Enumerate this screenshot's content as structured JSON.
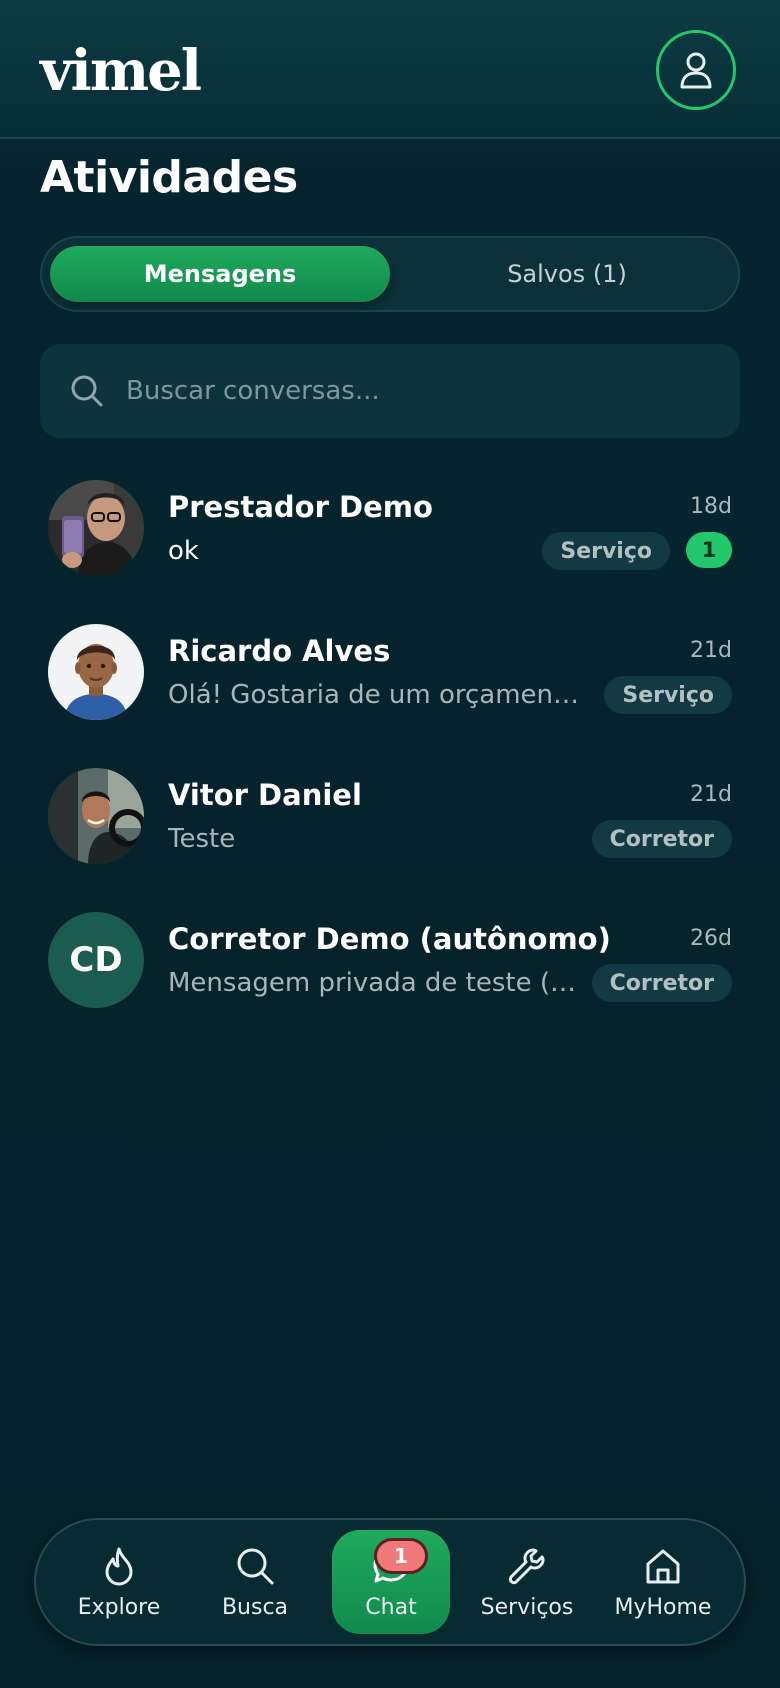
{
  "header": {
    "logo_text": "vimel",
    "profile_icon": "user-icon"
  },
  "page": {
    "title": "Atividades"
  },
  "tabs": [
    {
      "label": "Mensagens",
      "active": true
    },
    {
      "label": "Salvos (1)",
      "active": false
    }
  ],
  "search": {
    "placeholder": "Buscar conversas...",
    "value": "",
    "icon": "search-icon"
  },
  "conversations": [
    {
      "name": "Prestador Demo",
      "message": "ok",
      "time": "18d",
      "tag": "Serviço",
      "unread": "1",
      "avatar": "photo-avatar"
    },
    {
      "name": "Ricardo Alves",
      "message": "Olá! Gostaria de um orçamento para...",
      "time": "21d",
      "tag": "Serviço",
      "avatar": "illustrated-avatar"
    },
    {
      "name": "Vitor Daniel",
      "message": "Teste",
      "time": "21d",
      "tag": "Corretor",
      "avatar": "photo-avatar"
    },
    {
      "name": "Corretor Demo (autônomo)",
      "message": "Mensagem privada de teste (pendente)",
      "time": "26d",
      "tag": "Corretor",
      "avatar_initials": "CD"
    }
  ],
  "bottom_nav": [
    {
      "label": "Explore",
      "icon": "flame-icon"
    },
    {
      "label": "Busca",
      "icon": "search-icon"
    },
    {
      "label": "Chat",
      "icon": "chat-icon",
      "active": true,
      "badge": "1"
    },
    {
      "label": "Serviços",
      "icon": "wrench-icon"
    },
    {
      "label": "MyHome",
      "icon": "home-icon"
    }
  ],
  "colors": {
    "background": "#062630",
    "accent": "#22c96c",
    "accent_dark": "#128a4c",
    "badge_red": "#f07a7a",
    "tag_bg": "#133942"
  }
}
